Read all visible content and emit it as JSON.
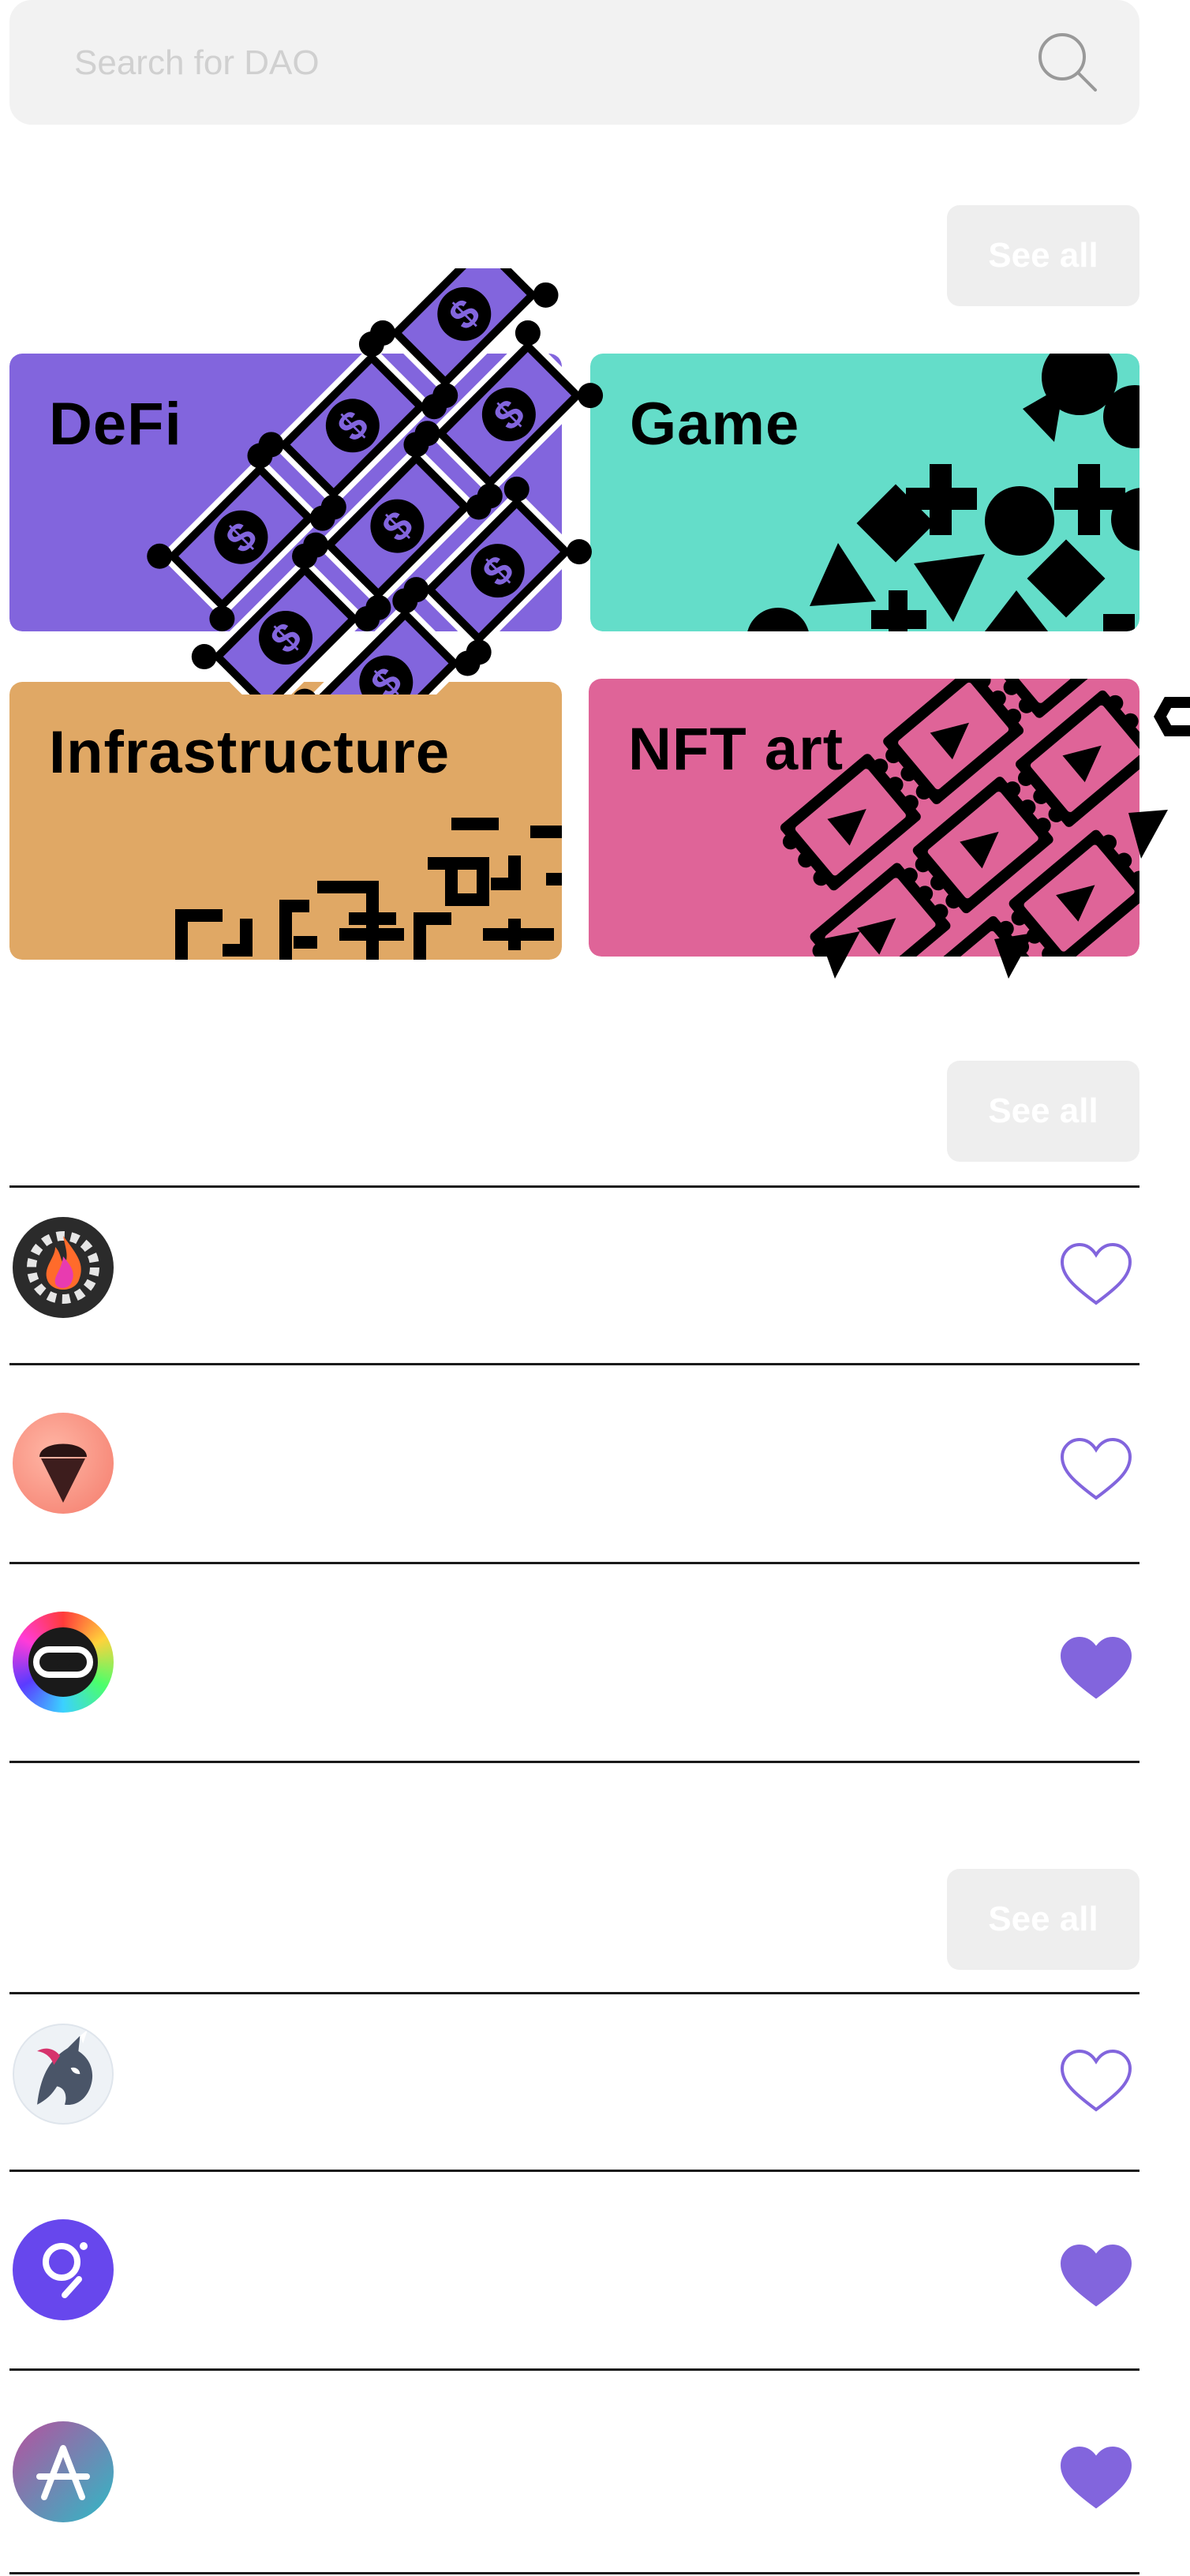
{
  "search": {
    "placeholder": "Search for DAO"
  },
  "sections": {
    "categories": {
      "see_all_label": "See all"
    },
    "list_a": {
      "see_all_label": "See all"
    },
    "list_b": {
      "see_all_label": "See all"
    }
  },
  "categories": [
    {
      "label": "DeFi",
      "color": "#8265dd",
      "icon": "dollar-bills-pattern"
    },
    {
      "label": "Game",
      "color": "#64ddc9",
      "icon": "game-shapes-pattern"
    },
    {
      "label": "Infrastructure",
      "color": "#e0a865",
      "icon": "maze-pattern"
    },
    {
      "label": "NFT art",
      "color": "#df6498",
      "icon": "play-tickets-pattern"
    }
  ],
  "list_a": [
    {
      "avatar": "flame-gear-logo",
      "favorited": false
    },
    {
      "avatar": "ice-cream-logo",
      "favorited": false
    },
    {
      "avatar": "rainbow-loop-logo",
      "favorited": true
    }
  ],
  "list_b": [
    {
      "avatar": "unicorn-logo",
      "favorited": false
    },
    {
      "avatar": "graph-logo",
      "favorited": true
    },
    {
      "avatar": "aave-logo",
      "favorited": true
    }
  ],
  "colors": {
    "accent": "#8265dd",
    "search_bg": "#f2f2f2",
    "see_all_bg": "#eeeeee"
  }
}
